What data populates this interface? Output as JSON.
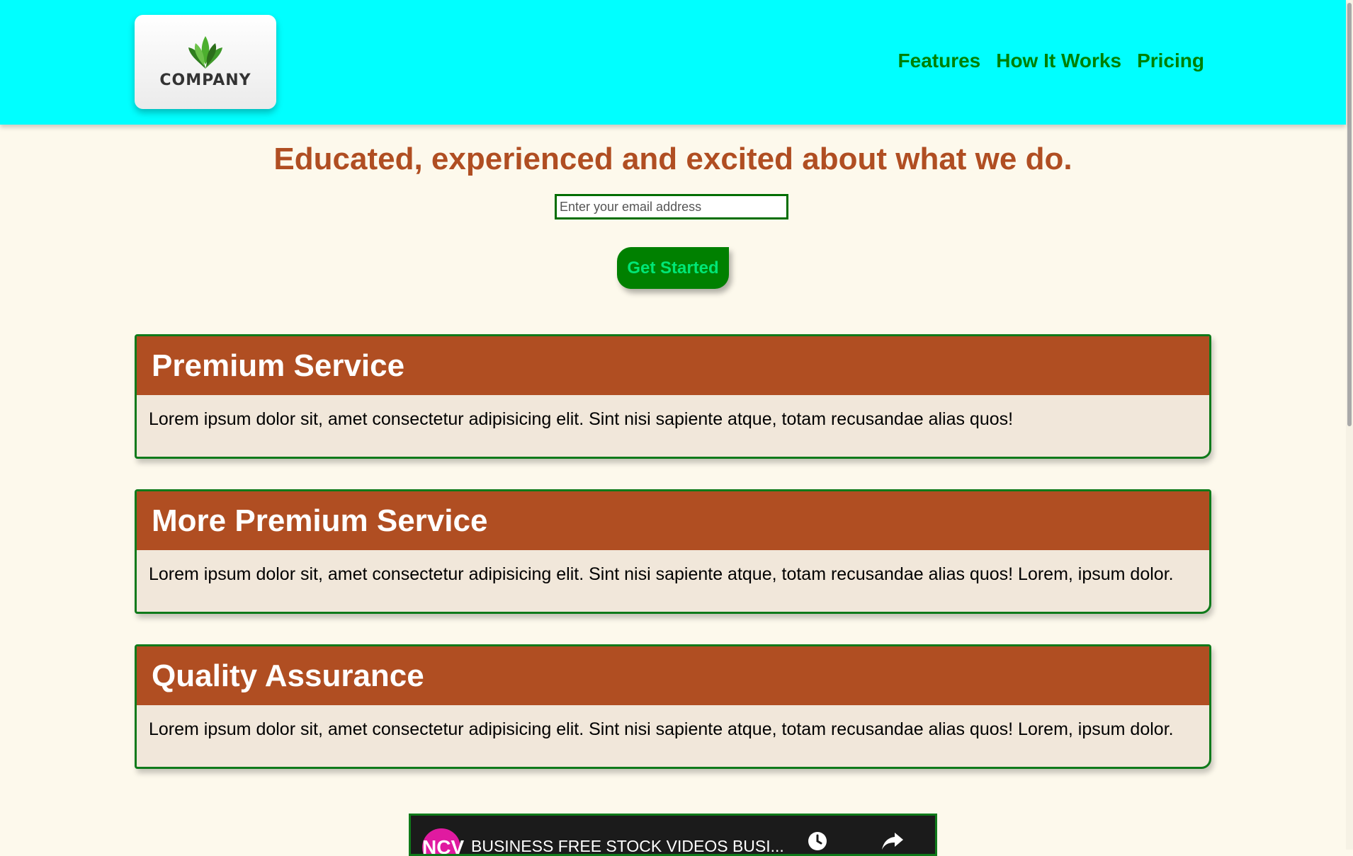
{
  "header": {
    "logo_text": "COMPANY",
    "nav": [
      "Features",
      "How It Works",
      "Pricing"
    ]
  },
  "hero": {
    "title": "Educated, experienced and excited about what we do.",
    "email_placeholder": "Enter your email address",
    "cta_label": "Get Started"
  },
  "cards": [
    {
      "title": "Premium Service",
      "body": "Lorem ipsum dolor sit, amet consectetur adipisicing elit. Sint nisi sapiente atque, totam recusandae alias quos!"
    },
    {
      "title": "More Premium Service",
      "body": "Lorem ipsum dolor sit, amet consectetur adipisicing elit. Sint nisi sapiente atque, totam recusandae alias quos! Lorem, ipsum dolor."
    },
    {
      "title": "Quality Assurance",
      "body": "Lorem ipsum dolor sit, amet consectetur adipisicing elit. Sint nisi sapiente atque, totam recusandae alias quos! Lorem, ipsum dolor."
    }
  ],
  "video": {
    "channel_logo_text": "NCV",
    "title": "BUSINESS FREE STOCK VIDEOS BUSI..."
  },
  "colors": {
    "header_bg": "#00ffff",
    "nav_link": "#008000",
    "accent": "#b04e22",
    "card_body_bg": "#f1e7da",
    "page_bg": "#fdf9ec"
  },
  "icons": [
    "leaf-logo-icon",
    "clock-icon",
    "share-icon"
  ]
}
